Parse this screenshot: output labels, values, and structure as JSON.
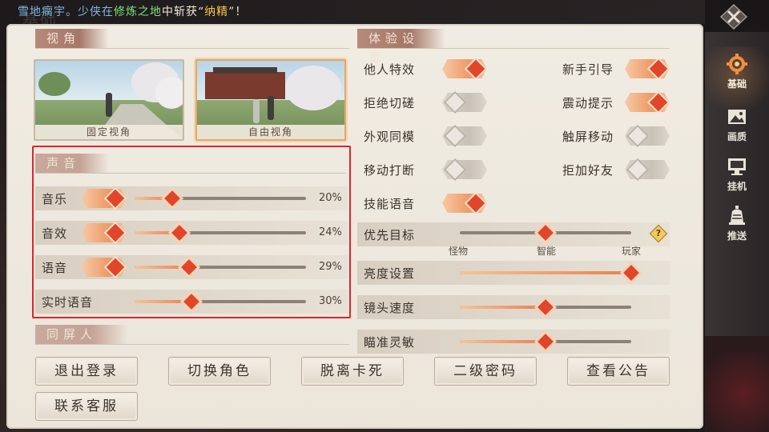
{
  "broadcast": {
    "prefix": "雪地瘸宇。少侠在",
    "place": "修炼之地",
    "mid": "中斩获“",
    "item": "纳精",
    "suffix": "”！"
  },
  "watermark": "基础",
  "view": {
    "title": "视角",
    "options": [
      {
        "label": "固定视角",
        "selected": false
      },
      {
        "label": "自由视角",
        "selected": true
      }
    ]
  },
  "sound": {
    "title": "声音",
    "rows": [
      {
        "label": "音乐",
        "toggle": true,
        "percent": 20,
        "value_text": "20%"
      },
      {
        "label": "音效",
        "toggle": true,
        "percent": 24,
        "value_text": "24%"
      },
      {
        "label": "语音",
        "toggle": true,
        "percent": 29,
        "value_text": "29%"
      },
      {
        "label": "实时语音",
        "toggle": null,
        "percent": 30,
        "value_text": "30%"
      }
    ]
  },
  "same_screen": {
    "title": "同屏人数"
  },
  "experience": {
    "title": "体验设置",
    "toggles": [
      {
        "label": "他人特效",
        "on": true
      },
      {
        "label": "新手引导",
        "on": true
      },
      {
        "label": "拒绝切磋",
        "on": false
      },
      {
        "label": "震动提示",
        "on": true
      },
      {
        "label": "外观同模",
        "on": false
      },
      {
        "label": "触屏移动",
        "on": false
      },
      {
        "label": "移动打断",
        "on": false
      },
      {
        "label": "拒加好友",
        "on": false
      },
      {
        "label": "技能语音",
        "on": true
      }
    ],
    "priority": {
      "label": "优先目标",
      "ticks": [
        "怪物",
        "智能",
        "玩家"
      ],
      "level": 0.5,
      "help": "?"
    },
    "sliders": [
      {
        "label": "亮度设置",
        "level": 1.0
      },
      {
        "label": "镜头速度",
        "level": 0.5
      },
      {
        "label": "瞄准灵敏",
        "level": 0.5
      }
    ]
  },
  "buttons": [
    "退出登录",
    "切换角色",
    "脱离卡死",
    "二级密码",
    "查看公告",
    "联系客服"
  ],
  "sidebar": [
    {
      "label": "基础",
      "icon": "gear-icon",
      "active": true
    },
    {
      "label": "画质",
      "icon": "picture-icon",
      "active": false
    },
    {
      "label": "挂机",
      "icon": "monitor-icon",
      "active": false
    },
    {
      "label": "推送",
      "icon": "bell-icon",
      "active": false
    }
  ],
  "colors": {
    "accent": "#e2462a",
    "highlight_box": "#e0242b",
    "panel": "#efe9e0"
  }
}
